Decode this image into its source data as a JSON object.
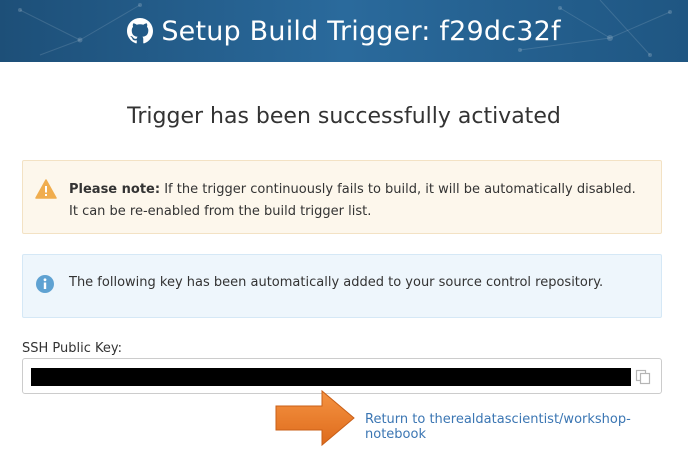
{
  "header": {
    "title": "Setup Build Trigger: f29dc32f",
    "icon": "github-icon",
    "background": "#23598a"
  },
  "main": {
    "activated_message": "Trigger has been successfully activated"
  },
  "warning_alert": {
    "icon": "warning-triangle-icon",
    "bold_text": "Please note:",
    "text": " If the trigger continuously fails to build, it will be automatically disabled. It can be re-enabled from the build trigger list.",
    "color": "#f0ad4e"
  },
  "info_alert": {
    "icon": "info-circle-icon",
    "text": "The following key has been automatically added to your source control repository.",
    "color": "#5fa2d2"
  },
  "ssh": {
    "label": "SSH Public Key:",
    "value": "ssh-rsa ████████████████████████████████████████████████████████████████████████████",
    "copy_icon": "copy-icon"
  },
  "footer": {
    "return_link": "Return to therealdatascientist/workshop-notebook",
    "link_color": "#3b76b3",
    "arrow_color": "#e8782a"
  }
}
